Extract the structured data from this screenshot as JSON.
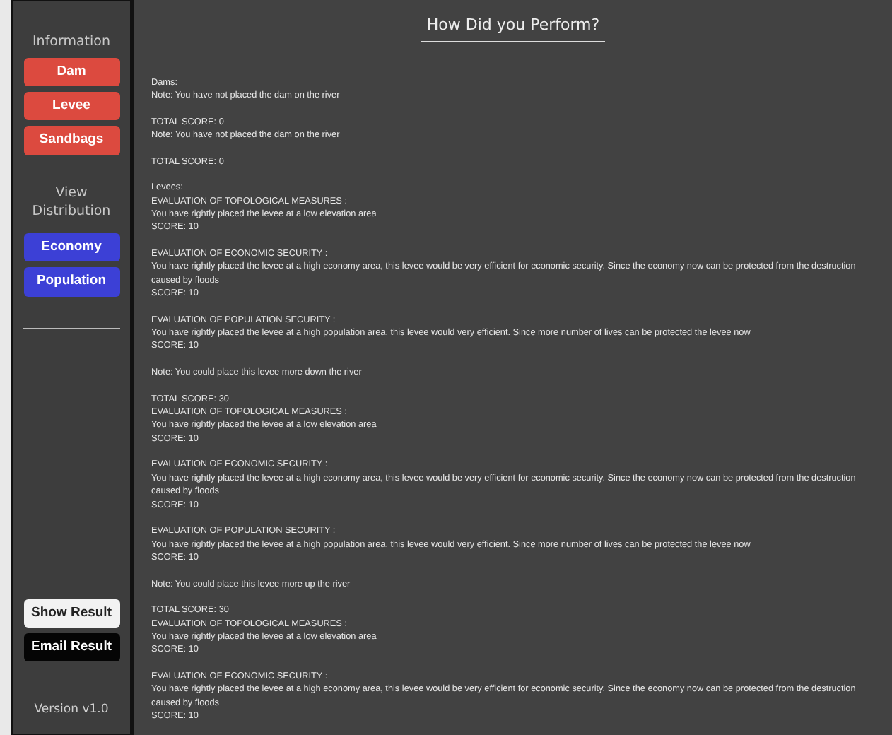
{
  "sidebar": {
    "heading": "Information",
    "info_buttons": [
      "Dam",
      "Levee",
      "Sandbags"
    ],
    "distribution_heading": "View Distribution",
    "distribution_buttons": [
      "Economy",
      "Population"
    ],
    "actions": [
      {
        "label": "Show Result",
        "kind": "light"
      },
      {
        "label": "Email Result",
        "kind": "dark"
      }
    ],
    "version": "Version v1.0"
  },
  "main": {
    "title": "How Did you Perform?",
    "blocks": [
      [
        "Dams:",
        "Note: You have not placed the dam on the river"
      ],
      [
        "TOTAL SCORE: 0",
        "Note: You have not placed the dam on the river"
      ],
      [
        "TOTAL SCORE: 0"
      ],
      [
        "Levees:",
        "EVALUATION OF TOPOLOGICAL MEASURES :",
        "You have rightly placed the levee at a low elevation area",
        "SCORE: 10"
      ],
      [
        "EVALUATION OF ECONOMIC SECURITY :",
        "You have rightly placed the levee at a high economy area, this levee would be very efficient for economic security. Since the economy now can be protected from the destruction caused by floods",
        "SCORE: 10"
      ],
      [
        "EVALUATION OF POPULATION SECURITY :",
        "You have rightly placed the levee at a high population area, this levee would very efficient. Since more number of lives can be protected the levee now",
        "SCORE: 10"
      ],
      [
        "Note: You could place this levee more down the river"
      ],
      [
        "TOTAL SCORE: 30",
        "EVALUATION OF TOPOLOGICAL MEASURES :",
        "You have rightly placed the levee at a low elevation area",
        "SCORE: 10"
      ],
      [
        "EVALUATION OF ECONOMIC SECURITY :",
        "You have rightly placed the levee at a high economy area, this levee would be very efficient for economic security. Since the economy now can be protected from the destruction caused by floods",
        "SCORE: 10"
      ],
      [
        "EVALUATION OF POPULATION SECURITY :",
        "You have rightly placed the levee at a high population area, this levee would very efficient. Since more number of lives can be protected the levee now",
        "SCORE: 10"
      ],
      [
        "Note: You could place this levee more up the river"
      ],
      [
        "TOTAL SCORE: 30",
        "EVALUATION OF TOPOLOGICAL MEASURES :",
        "You have rightly placed the levee at a low elevation area",
        "SCORE: 10"
      ],
      [
        "EVALUATION OF ECONOMIC SECURITY :",
        "You have rightly placed the levee at a high economy area, this levee would be very efficient for economic security. Since the economy now can be protected from the destruction caused by floods",
        "SCORE: 10"
      ]
    ]
  }
}
